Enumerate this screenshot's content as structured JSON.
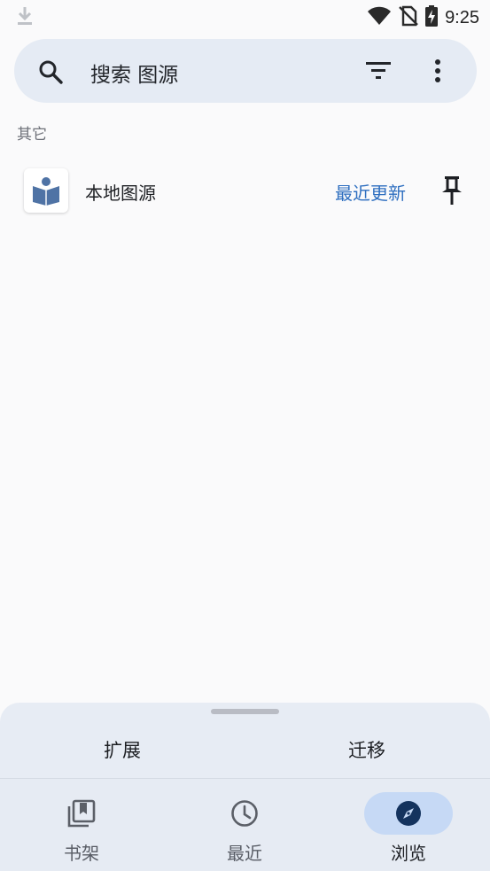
{
  "status_bar": {
    "time": "9:25",
    "icons": [
      "download-icon",
      "wifi-icon",
      "no-sim-icon",
      "battery-charging-icon"
    ]
  },
  "search": {
    "placeholder": "搜索 图源",
    "icons": [
      "search-icon",
      "filter-icon",
      "more-vert-icon"
    ]
  },
  "sections": [
    {
      "label": "其它",
      "items": [
        {
          "name": "本地图源",
          "action": "最近更新",
          "icon": "local-source-icon",
          "trailing_icon": "pin-icon"
        }
      ]
    }
  ],
  "sheet": {
    "tabs": [
      {
        "label": "扩展"
      },
      {
        "label": "迁移"
      }
    ]
  },
  "nav": {
    "items": [
      {
        "label": "书架",
        "icon": "library-icon",
        "active": false
      },
      {
        "label": "最近",
        "icon": "history-icon",
        "active": false
      },
      {
        "label": "浏览",
        "icon": "explore-icon",
        "active": true
      }
    ]
  },
  "colors": {
    "accent": "#2e6fc0",
    "surface": "#e5ebf4",
    "active_indicator": "#c6d9f5",
    "background": "#fafafb"
  }
}
